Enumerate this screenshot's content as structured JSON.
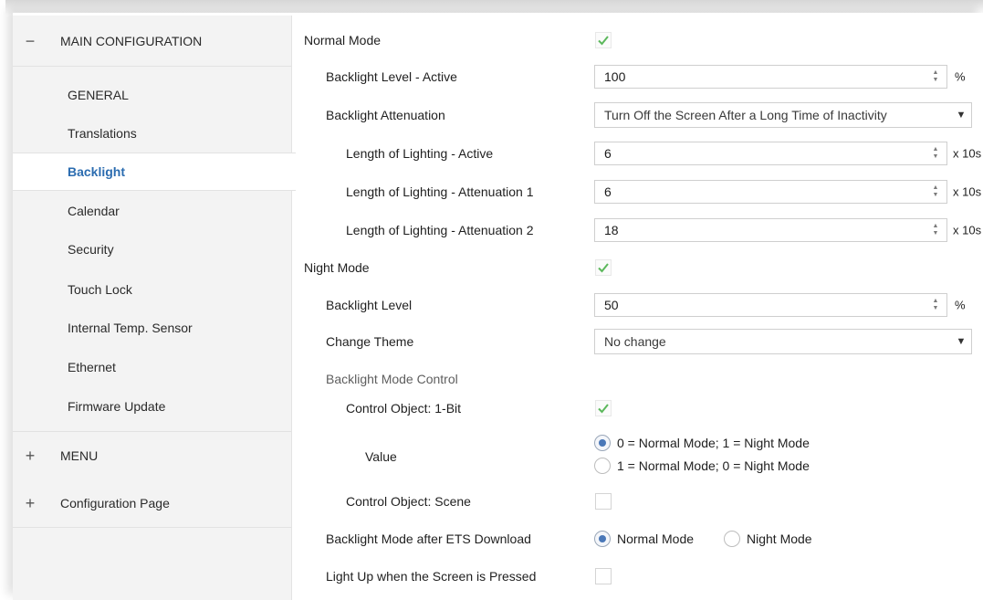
{
  "sidebar": {
    "sections": [
      {
        "sign": "−",
        "label": "MAIN CONFIGURATION"
      },
      {
        "sign": "+",
        "label": "MENU"
      },
      {
        "sign": "+",
        "label": "Configuration Page"
      }
    ],
    "items": [
      {
        "label": "GENERAL"
      },
      {
        "label": "Translations"
      },
      {
        "label": "Backlight"
      },
      {
        "label": "Calendar"
      },
      {
        "label": "Security"
      },
      {
        "label": "Touch Lock"
      },
      {
        "label": "Internal Temp. Sensor"
      },
      {
        "label": "Ethernet"
      },
      {
        "label": "Firmware Update"
      }
    ],
    "active_item": "Backlight"
  },
  "main": {
    "normal_mode": {
      "label": "Normal Mode",
      "checked": true
    },
    "backlight_level_active": {
      "label": "Backlight Level - Active",
      "value": "100",
      "unit": "%"
    },
    "backlight_attenuation": {
      "label": "Backlight Attenuation",
      "value": "Turn Off the Screen After a Long Time of Inactivity"
    },
    "length_active": {
      "label": "Length of Lighting - Active",
      "value": "6",
      "unit": "x 10s"
    },
    "length_att1": {
      "label": "Length of Lighting - Attenuation 1",
      "value": "6",
      "unit": "x 10s"
    },
    "length_att2": {
      "label": "Length of Lighting - Attenuation 2",
      "value": "18",
      "unit": "x 10s"
    },
    "night_mode": {
      "label": "Night Mode",
      "checked": true
    },
    "backlight_level": {
      "label": "Backlight Level",
      "value": "50",
      "unit": "%"
    },
    "change_theme": {
      "label": "Change Theme",
      "value": "No change"
    },
    "backlight_mode_control": {
      "label": "Backlight Mode Control"
    },
    "control_object_1bit": {
      "label": "Control Object: 1-Bit",
      "checked": true
    },
    "value": {
      "label": "Value",
      "options": [
        "0 = Normal Mode; 1 = Night Mode",
        "1 = Normal Mode; 0 = Night Mode"
      ],
      "selected": 0
    },
    "control_object_scene": {
      "label": "Control Object: Scene",
      "checked": false
    },
    "mode_after_download": {
      "label": "Backlight Mode after ETS Download",
      "options": [
        "Normal Mode",
        "Night Mode"
      ],
      "selected": 0
    },
    "light_up_pressed": {
      "label": "Light Up when the Screen is Pressed",
      "checked": false
    }
  },
  "colors": {
    "accent": "#2b6cb0",
    "check": "#5cb85c",
    "radio": "#4a78b8"
  }
}
